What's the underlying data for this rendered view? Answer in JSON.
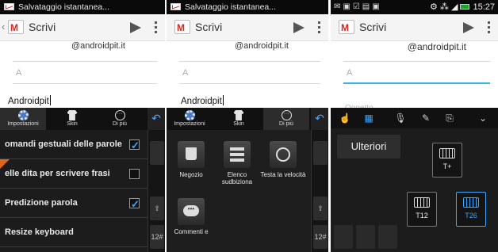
{
  "panel1": {
    "status_text": "Salvataggio istantanea...",
    "title": "Scrivi",
    "to_value": "@androidpit.it",
    "cc_placeholder": "A",
    "body_text": "Androidpit",
    "tabs": [
      {
        "label": "Impostazioni",
        "icon": "gear-icon"
      },
      {
        "label": "Skin",
        "icon": "shirt-icon"
      },
      {
        "label": "Di più",
        "icon": "more-icon"
      }
    ],
    "settings": [
      {
        "label": "omandi gestuali delle parole",
        "checked": true
      },
      {
        "label": "elle dita per scrivere frasi",
        "checked": false
      },
      {
        "label": "Predizione parola",
        "checked": true
      },
      {
        "label": "Resize keyboard"
      }
    ],
    "side_key": "12#"
  },
  "panel2": {
    "status_text": "Salvataggio istantanea...",
    "title": "Scrivi",
    "to_value": "@androidpit.it",
    "cc_placeholder": "A",
    "body_text": "Androidpit",
    "tabs": [
      {
        "label": "Impostazioni",
        "icon": "gear-icon"
      },
      {
        "label": "Skin",
        "icon": "shirt-icon"
      },
      {
        "label": "Di più",
        "icon": "more-icon"
      }
    ],
    "apps": [
      {
        "label": "Negozio",
        "icon": "shopping-bag-icon"
      },
      {
        "label": "Elenco sudbiziona",
        "icon": "list-icon"
      },
      {
        "label": "Testa la velocità",
        "icon": "speedometer-icon"
      },
      {
        "label": "Commenti e",
        "icon": "chat-bubble-icon"
      }
    ],
    "side_key": "12#"
  },
  "panel3": {
    "time": "15:27",
    "title": "Scrivi",
    "to_value": "@androidpit.it",
    "cc_placeholder": "A",
    "subject_hint": "Oggetto",
    "more_label": "Ulteriori",
    "modes": [
      {
        "label": "T+",
        "selected": false
      },
      {
        "label": "T12",
        "selected": false
      },
      {
        "label": "T26",
        "selected": true
      }
    ]
  },
  "colors": {
    "accent": "#3ea6ff",
    "gmail_red": "#d4281f",
    "keyboard_bg": "#1c1c1c"
  }
}
